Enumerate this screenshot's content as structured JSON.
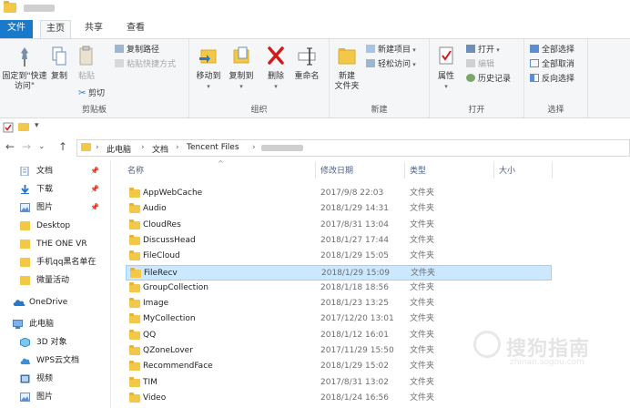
{
  "tabs": {
    "file": "文件",
    "home": "主页",
    "share": "共享",
    "view": "查看"
  },
  "ribbon": {
    "clipboard": {
      "pin_quick": "固定到\"快速访问\"",
      "copy": "复制",
      "paste": "粘贴",
      "copy_path": "复制路径",
      "paste_shortcut": "粘贴快捷方式",
      "cut": "剪切",
      "label": "剪贴板"
    },
    "organize": {
      "move_to": "移动到",
      "copy_to": "复制到",
      "delete": "删除",
      "rename": "重命名",
      "label": "组织"
    },
    "new": {
      "new_folder": "新建\n文件夹",
      "new_item": "新建项目",
      "easy_access": "轻松访问",
      "label": "新建"
    },
    "open": {
      "properties": "属性",
      "open": "打开",
      "edit": "编辑",
      "history": "历史记录",
      "label": "打开"
    },
    "select": {
      "select_all": "全部选择",
      "select_none": "全部取消",
      "invert": "反向选择",
      "label": "选择"
    }
  },
  "address": {
    "this_pc": "此电脑",
    "documents": "文档",
    "tencent": "Tencent Files"
  },
  "nav": {
    "items": [
      {
        "label": "文档",
        "icon": "document-icon"
      },
      {
        "label": "下载",
        "icon": "download-icon"
      },
      {
        "label": "图片",
        "icon": "pictures-icon"
      },
      {
        "label": "Desktop",
        "icon": "folder-icon"
      },
      {
        "label": "THE ONE VR",
        "icon": "folder-icon"
      },
      {
        "label": "手机qq黑名单在",
        "icon": "folder-icon"
      },
      {
        "label": "微量活动",
        "icon": "folder-icon"
      },
      {
        "label": "OneDrive",
        "icon": "cloud-icon"
      },
      {
        "label": "此电脑",
        "icon": "computer-icon"
      },
      {
        "label": "3D 对象",
        "icon": "cube-icon"
      },
      {
        "label": "WPS云文档",
        "icon": "wps-cloud-icon"
      },
      {
        "label": "视频",
        "icon": "video-icon"
      },
      {
        "label": "图片",
        "icon": "pictures-icon"
      }
    ]
  },
  "columns": {
    "name": "名称",
    "date": "修改日期",
    "type": "类型",
    "size": "大小"
  },
  "files": [
    {
      "name": "AppWebCache",
      "date": "2017/9/8 22:03",
      "type": "文件夹"
    },
    {
      "name": "Audio",
      "date": "2018/1/29 14:31",
      "type": "文件夹"
    },
    {
      "name": "CloudRes",
      "date": "2017/8/31 13:04",
      "type": "文件夹"
    },
    {
      "name": "DiscussHead",
      "date": "2018/1/27 17:44",
      "type": "文件夹"
    },
    {
      "name": "FileCloud",
      "date": "2018/1/29 15:05",
      "type": "文件夹"
    },
    {
      "name": "FileRecv",
      "date": "2018/1/29 15:09",
      "type": "文件夹"
    },
    {
      "name": "GroupCollection",
      "date": "2018/1/18 18:56",
      "type": "文件夹"
    },
    {
      "name": "Image",
      "date": "2018/1/23 13:25",
      "type": "文件夹"
    },
    {
      "name": "MyCollection",
      "date": "2017/12/20 13:01",
      "type": "文件夹"
    },
    {
      "name": "QQ",
      "date": "2018/1/12 16:01",
      "type": "文件夹"
    },
    {
      "name": "QZoneLover",
      "date": "2017/11/29 15:50",
      "type": "文件夹"
    },
    {
      "name": "RecommendFace",
      "date": "2018/1/29 15:02",
      "type": "文件夹"
    },
    {
      "name": "TIM",
      "date": "2017/8/31 13:02",
      "type": "文件夹"
    },
    {
      "name": "Video",
      "date": "2018/1/24 16:56",
      "type": "文件夹"
    }
  ],
  "selected_index": 5,
  "watermark": {
    "text": "搜狗指南",
    "sub": "zhinan.sogou.com"
  },
  "colors": {
    "accent": "#1979ca",
    "folder": "#f3c748",
    "selection": "#cce8ff",
    "delete": "#d11b1b"
  }
}
